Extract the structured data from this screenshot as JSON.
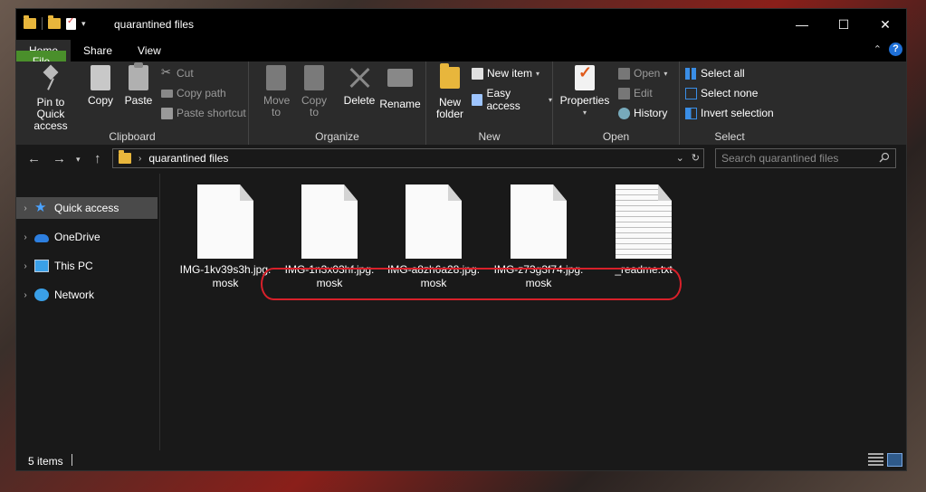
{
  "window": {
    "title": "quarantined files"
  },
  "window_buttons": {
    "minimize": "—",
    "maximize": "☐",
    "close": "✕"
  },
  "tabs": [
    {
      "label": "File"
    },
    {
      "label": "Home"
    },
    {
      "label": "Share"
    },
    {
      "label": "View"
    }
  ],
  "help": {
    "label": "?"
  },
  "ribbon": {
    "clipboard": {
      "label": "Clipboard",
      "pin": "Pin to Quick access",
      "copy": "Copy",
      "paste": "Paste",
      "cut": "Cut",
      "copy_path": "Copy path",
      "paste_shortcut": "Paste shortcut"
    },
    "organize": {
      "label": "Organize",
      "move_to": "Move to",
      "copy_to": "Copy to",
      "delete": "Delete",
      "rename": "Rename"
    },
    "new": {
      "label": "New",
      "new_folder": "New folder",
      "new_item": "New item",
      "easy_access": "Easy access"
    },
    "open": {
      "label": "Open",
      "properties": "Properties",
      "open": "Open",
      "edit": "Edit",
      "history": "History"
    },
    "select": {
      "label": "Select",
      "select_all": "Select all",
      "select_none": "Select none",
      "invert": "Invert selection"
    }
  },
  "address": {
    "path": "quarantined files"
  },
  "search": {
    "placeholder": "Search quarantined files"
  },
  "nav": [
    {
      "label": "Quick access",
      "selected": true
    },
    {
      "label": "OneDrive"
    },
    {
      "label": "This PC"
    },
    {
      "label": "Network"
    }
  ],
  "files": [
    {
      "name": "IMG-1kv39s3h.jpg.mosk",
      "type": "blank"
    },
    {
      "name": "IMG-1n3x03hf.jpg.mosk",
      "type": "blank"
    },
    {
      "name": "IMG-a8zh6a28.jpg.mosk",
      "type": "blank"
    },
    {
      "name": "IMG-z73g3f74.jpg.mosk",
      "type": "blank"
    },
    {
      "name": "_readme.txt",
      "type": "text"
    }
  ],
  "status": {
    "items": "5 items"
  },
  "colors": {
    "file_tab": "#4a8f2b",
    "highlight": "#d8202a",
    "accent": "#1e6fd6"
  }
}
